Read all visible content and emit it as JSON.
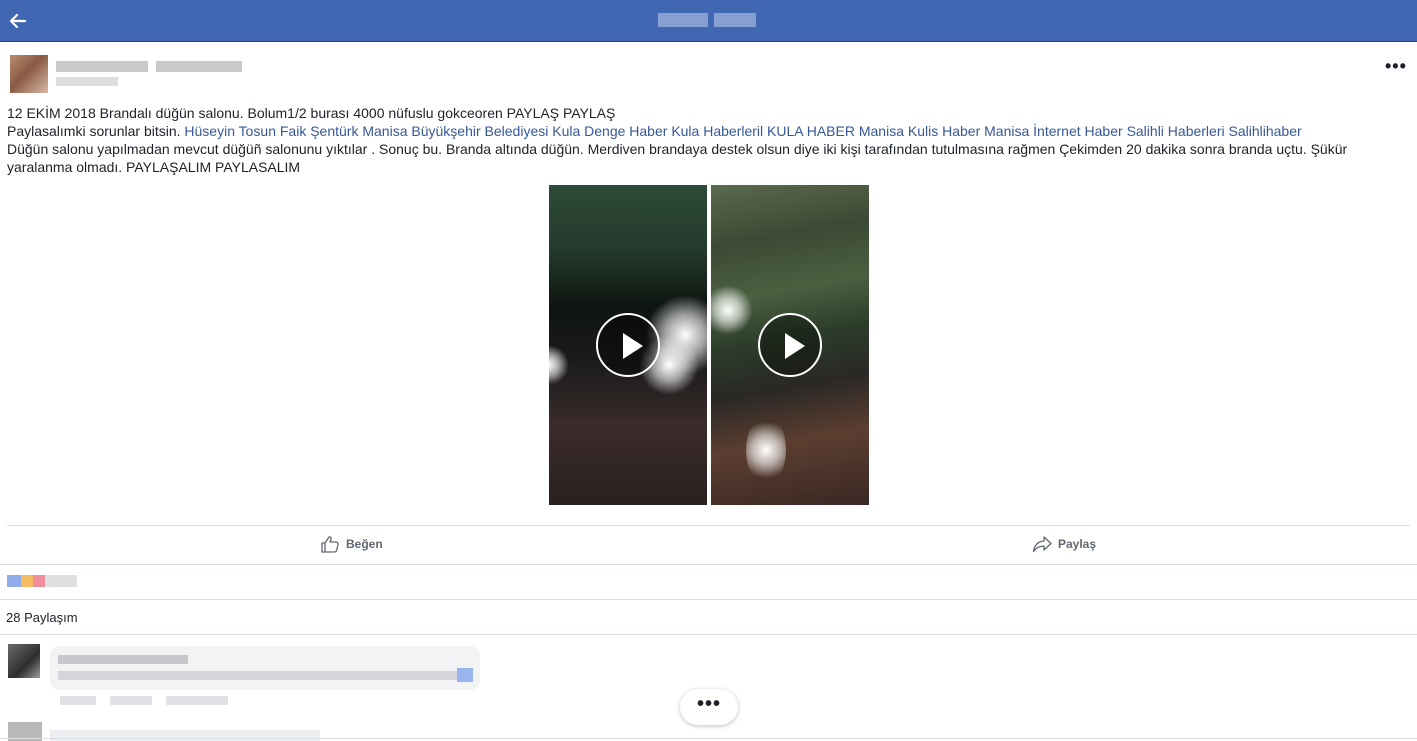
{
  "post": {
    "text_line1": "12 EKİM 2018 Brandalı düğün salonu. Bolum1/2 burası 4000 nüfuslu gokceoren PAYLAŞ PAYLAŞ",
    "text_line2_prefix": "Paylasalımki sorunlar bitsin.",
    "tags": [
      "Hüseyin Tosun",
      "Faik Şentürk",
      "Manisa Büyükşehir Belediyesi",
      "Kula Denge Haber",
      "Kula Haberleril",
      "KULA HABER",
      "Manisa Kulis Haber",
      "Manisa İnternet Haber",
      "Salihli Haberleri",
      "Salihlihaber"
    ],
    "text_line3": "Düğün salonu yapılmadan mevcut düğüñ salonunu yıktılar . Sonuç bu. Branda altında düğün. Merdiven brandaya destek olsun diye iki kişi tarafından tutulmasına rağmen Çekimden 20 dakika sonra branda uçtu. Şükür yaralanma olmadı. PAYLAŞALIM PAYLASALIM"
  },
  "actions": {
    "like_label": "Beğen",
    "share_label": "Paylaş"
  },
  "shares_count": "28 Paylaşım",
  "load_more": "•••",
  "colors": {
    "header_bg": "#4267b2",
    "link": "#365899",
    "divider": "#dadde1"
  }
}
